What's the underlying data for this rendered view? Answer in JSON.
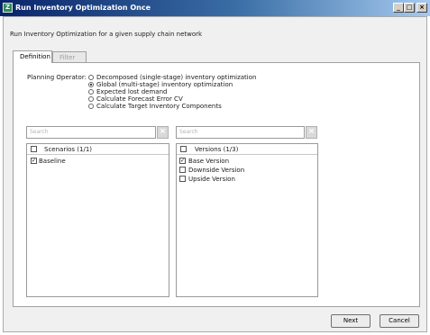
{
  "window": {
    "title": "Run Inventory Optimization Once",
    "controls": {
      "minimize": "_",
      "maximize": "□",
      "close": "×"
    },
    "app_icon": "Z"
  },
  "description": "Run Inventory Optimization for a given supply chain network",
  "tabs": [
    {
      "label": "Definition",
      "active": true
    },
    {
      "label": "Filter",
      "active": false
    }
  ],
  "planning_operator": {
    "label": "Planning Operator:",
    "options": [
      {
        "label": "Decomposed (single-stage) inventory optimization",
        "selected": false
      },
      {
        "label": "Global (multi-stage) inventory optimization",
        "selected": true
      },
      {
        "label": "Expected lost demand",
        "selected": false
      },
      {
        "label": "Calculate Forecast Error CV",
        "selected": false
      },
      {
        "label": "Calculate Target Inventory Components",
        "selected": false
      }
    ]
  },
  "scenarios": {
    "search_placeholder": "Search",
    "header": "Scenarios (1/1)",
    "items": [
      {
        "label": "Baseline",
        "checked": true
      }
    ]
  },
  "versions": {
    "search_placeholder": "Search",
    "header": "Versions (1/3)",
    "items": [
      {
        "label": "Base Version",
        "checked": true
      },
      {
        "label": "Downside Version",
        "checked": false
      },
      {
        "label": "Upside Version",
        "checked": false
      }
    ]
  },
  "buttons": {
    "next": "Next",
    "cancel": "Cancel"
  },
  "colors": {
    "title_bar_start": "#0a246a",
    "title_bar_end": "#a6caf0",
    "panel_background": "#f0f0f0"
  }
}
